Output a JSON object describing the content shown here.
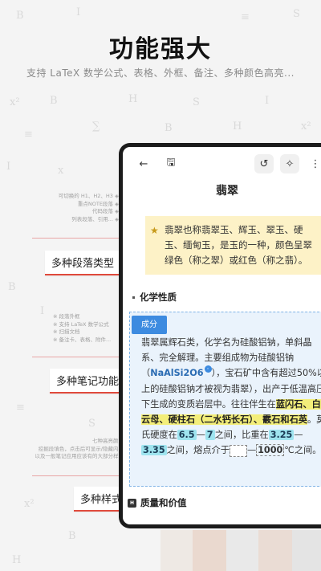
{
  "header": {
    "title": "功能强大",
    "subtitle": "支持 LaTeX 数学公式、表格、外框、备注、多种颜色高亮..."
  },
  "features": [
    {
      "label": "多种段落类型",
      "lines": [
        "可切换的 H1、H2、H3 ◈",
        "重点NOTE段落 ◈",
        "代码段落 ◈",
        "列表段落、引用... ◈"
      ]
    },
    {
      "label": "多种笔记功能",
      "lines": [
        "※ 段落外框",
        "※ 支持 LaTeX 数学公式",
        "※ 扫描文档",
        "※ 备注卡、表格、附件..."
      ]
    },
    {
      "label": "多种样式",
      "lines": [
        "七种高亮颜色",
        "挖掘段填色，点击后可显示/隐藏内容",
        "以及一般笔记应用应该有的大部分样式"
      ]
    }
  ],
  "toolbar": {
    "back_icon": "←",
    "save_icon": "🖫",
    "undo_icon": "↺",
    "magic_icon": "✧",
    "more_icon": "⋮"
  },
  "document": {
    "title": "翡翠",
    "note": "翡翠也称翡翠玉、辉玉、翠玉、硬玉、缅甸玉，是玉的一种，颜色呈翠绿色（称之翠）或红色（称之翡）。",
    "section1": "化学性质",
    "frame_tag": "成分",
    "p_a": "翡翠属辉石类，化学名为硅酸铝钠，单斜晶系、完全解理。主要组成物为硅酸铝钠（",
    "formula": "NaAlSi2O6",
    "formula_badge": "◦",
    "p_b": "），宝石矿中含有超过50%以上的硅酸铝钠才被视为翡翠），出产于低温高压下生成的变质岩层中。往往伴生在",
    "minerals": "蓝闪石、白云母、硬柱石（二水钙长石）、霰石和石英",
    "p_c": "。莫氏硬度在",
    "h_min": "6.5",
    "dash1": "—",
    "h_max": "7",
    "p_d": "之间，比重在",
    "g_min": "3.25",
    "dash2": "—",
    "g_max": "3.35",
    "p_e": "之间，熔点介于",
    "dash3": "—",
    "m_max": "1000",
    "p_f": "℃之间。",
    "section2": "质量和价值",
    "section2_icon": "H"
  },
  "colors": {
    "accent_red": "#e04a3c",
    "note_bg": "#fdf2c7",
    "frame_bg": "#eaf3fc",
    "frame_border": "#7fb3e6",
    "tag_blue": "#3d8be0",
    "highlight_yellow": "#f3ee7a",
    "highlight_cyan": "#9ee4ef"
  }
}
